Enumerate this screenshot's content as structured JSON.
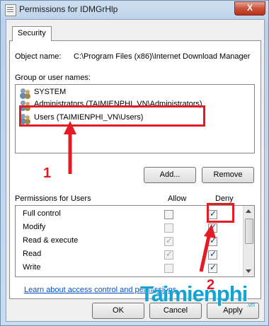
{
  "window": {
    "title": "Permissions for IDMGrHlp",
    "close_glyph": "X"
  },
  "tab": {
    "label": "Security"
  },
  "object": {
    "label": "Object name:",
    "value": "C:\\Program Files (x86)\\Internet Download Manager"
  },
  "groups": {
    "label": "Group or user names:",
    "items": [
      {
        "name": "SYSTEM",
        "icon": "users-group-icon"
      },
      {
        "name": "Administrators (TAIMIENPHI_VN\\Administrators)",
        "icon": "users-group-icon"
      },
      {
        "name": "Users (TAIMIENPHI_VN\\Users)",
        "icon": "users-group-icon",
        "selected": true
      }
    ]
  },
  "buttons": {
    "add": "Add...",
    "remove": "Remove",
    "ok": "OK",
    "cancel": "Cancel",
    "apply": "Apply"
  },
  "permissions": {
    "header": "Permissions for Users",
    "allow_label": "Allow",
    "deny_label": "Deny",
    "rows": [
      {
        "name": "Full control",
        "allow": false,
        "deny": true
      },
      {
        "name": "Modify",
        "allow": false,
        "deny": true
      },
      {
        "name": "Read & execute",
        "allow": true,
        "deny": true
      },
      {
        "name": "Read",
        "allow": true,
        "deny": true
      },
      {
        "name": "Write",
        "allow": false,
        "deny": true
      }
    ]
  },
  "link": {
    "text": "Learn about access control and permissions"
  },
  "annotations": {
    "step1": "1",
    "step2": "2",
    "color": "#e21b24"
  },
  "watermark": {
    "text": "Taimienphi",
    "suffix": ".vn"
  }
}
